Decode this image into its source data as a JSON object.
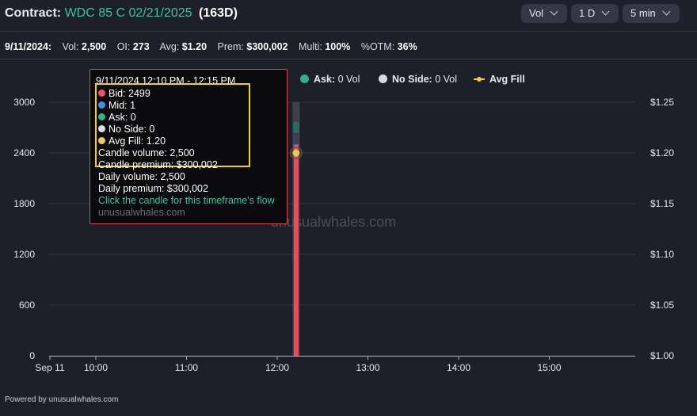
{
  "header": {
    "label": "Contract:",
    "contract": "WDC 85 C 02/21/2025",
    "dte": "(163D)",
    "controls": [
      {
        "label": "Vol"
      },
      {
        "label": "1 D"
      },
      {
        "label": "5 min"
      }
    ]
  },
  "stats": {
    "date": "9/11/2024:",
    "items": [
      {
        "label": "Vol:",
        "value": "2,500"
      },
      {
        "label": "OI:",
        "value": "273"
      },
      {
        "label": "Avg:",
        "value": "$1.20"
      },
      {
        "label": "Prem:",
        "value": "$300,002"
      },
      {
        "label": "Multi:",
        "value": "100%"
      },
      {
        "label": "%OTM:",
        "value": "36%"
      }
    ]
  },
  "legend": [
    {
      "label": "Ask:",
      "value": "0 Vol",
      "color": "#2fb28a",
      "marker": "dot"
    },
    {
      "label": "No Side:",
      "value": "0 Vol",
      "color": "#d9d9de",
      "marker": "dot"
    },
    {
      "label": "Avg Fill",
      "value": "",
      "color": "#f0c85a",
      "marker": "line"
    }
  ],
  "watermark": "unusualwhales.com",
  "tooltip": {
    "time": "9/11/2024 12:10 PM - 12:15 PM",
    "rows": [
      {
        "text": "Bid: 2499",
        "color": "#f0525f"
      },
      {
        "text": "Mid: 1",
        "color": "#3d8ff5"
      },
      {
        "text": "Ask: 0",
        "color": "#2fb28a"
      },
      {
        "text": "No Side: 0",
        "color": "#e0e0e4"
      },
      {
        "text": "Avg Fill: 1.20",
        "color": "#f0c85a"
      }
    ],
    "candle_volume": "Candle volume: 2,500",
    "candle_premium": "Candle premium: $300,002",
    "daily_volume": "Daily volume: 2,500",
    "daily_premium": "Daily premium: $300,002",
    "link": "Click the candle for this timeframe's flow",
    "site": "unusualwhales.com"
  },
  "footer": "Powered by unusualwhales.com",
  "chart_data": {
    "type": "bar",
    "x_ticks": [
      "Sep 11",
      "10:00",
      "11:00",
      "12:00",
      "13:00",
      "14:00",
      "15:00"
    ],
    "y_left_ticks": [
      "0",
      "600",
      "1200",
      "1800",
      "2400",
      "3000"
    ],
    "y_right_ticks": [
      "$1.00",
      "$1.05",
      "$1.10",
      "$1.15",
      "$1.20",
      "$1.25"
    ],
    "y_left_range": [
      0,
      3000
    ],
    "y_right_range": [
      1.0,
      1.25
    ],
    "grid": "horizontal",
    "bars": [
      {
        "time": "12:10",
        "bid": 2499,
        "mid": 1,
        "ask": 0,
        "no_side": 0
      }
    ],
    "avg_fill": [
      {
        "time": "12:10",
        "value": 1.2
      }
    ],
    "colors": {
      "bid": "#ee4b5b",
      "mid": "#3d8ff5",
      "ask": "#2fb28a",
      "no_side": "#d9d9de",
      "avg_fill": "#f0c85a",
      "highlight": "#4a4c57"
    }
  }
}
